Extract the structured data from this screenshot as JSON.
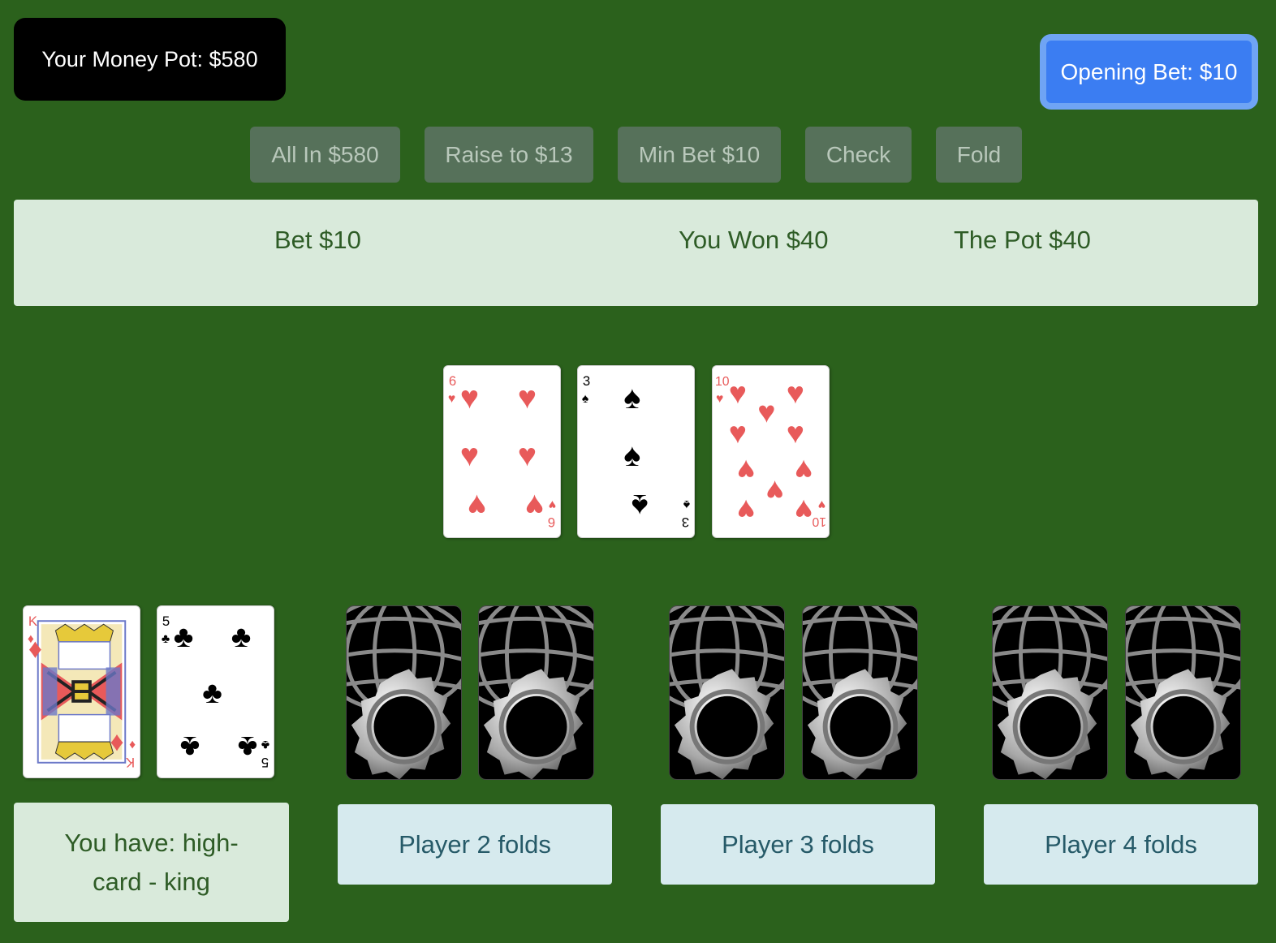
{
  "header": {
    "money_pot": "Your Money Pot: $580",
    "opening_bet": "Opening Bet: $10"
  },
  "actions": [
    {
      "label": "All In $580"
    },
    {
      "label": "Raise to $13"
    },
    {
      "label": "Min Bet $10"
    },
    {
      "label": "Check"
    },
    {
      "label": "Fold"
    }
  ],
  "status": {
    "bet": "Bet $10",
    "won": "You Won $40",
    "pot": "The Pot $40"
  },
  "community_cards": [
    {
      "rank": "6",
      "suit": "hearts"
    },
    {
      "rank": "3",
      "suit": "spades"
    },
    {
      "rank": "10",
      "suit": "hearts"
    }
  ],
  "your_cards": [
    {
      "rank": "K",
      "suit": "diamonds"
    },
    {
      "rank": "5",
      "suit": "clubs"
    }
  ],
  "players": [
    {
      "status": "You have: high-card - king"
    },
    {
      "status": "Player 2 folds"
    },
    {
      "status": "Player 3 folds"
    },
    {
      "status": "Player 4 folds"
    }
  ],
  "colors": {
    "table": "#2b611c",
    "accent": "#3b7df2",
    "hearts": "#e85a5a",
    "spades": "#000000"
  },
  "icons": {
    "card_back": "gear-globe-card-back-icon"
  }
}
